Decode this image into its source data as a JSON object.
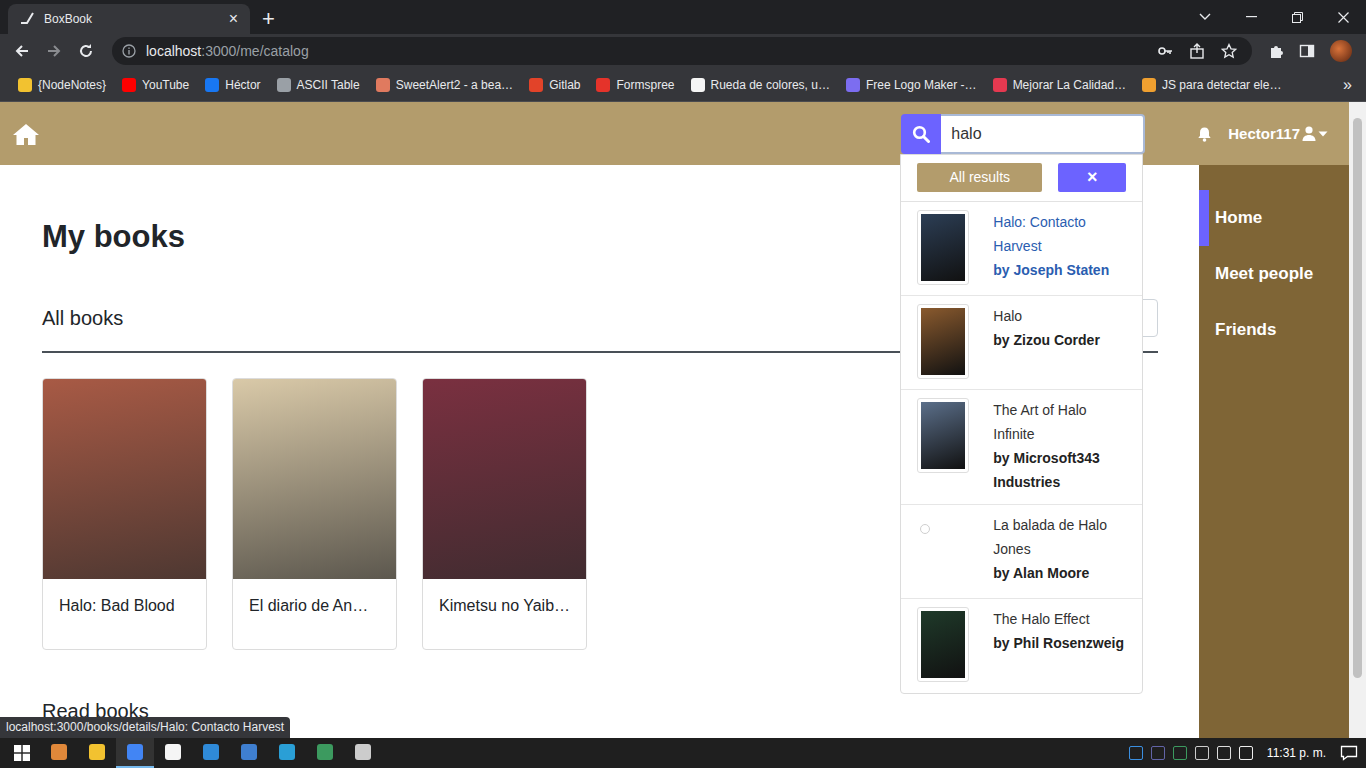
{
  "window": {
    "tab_title": "BoxBook",
    "tab_close": "×",
    "new_tab": "+"
  },
  "toolbar": {
    "url_host": "localhost",
    "url_path": ":3000/me/catalog"
  },
  "bookmarks": [
    {
      "label": "{NodeNotes}",
      "color": "#f2c230"
    },
    {
      "label": "YouTube",
      "color": "#ff0000"
    },
    {
      "label": "Héctor",
      "color": "#1877f2"
    },
    {
      "label": "ASCII Table",
      "color": "#9aa0a6"
    },
    {
      "label": "SweetAlert2 - a bea…",
      "color": "#e07a5f"
    },
    {
      "label": "Gitlab",
      "color": "#e24329"
    },
    {
      "label": "Formspree",
      "color": "#e5332a"
    },
    {
      "label": "Rueda de colores, u…",
      "color": "#f5f5f5"
    },
    {
      "label": "Free Logo Maker -…",
      "color": "#7c6df0"
    },
    {
      "label": "Mejorar La Calidad…",
      "color": "#e53950"
    },
    {
      "label": "JS para detectar ele…",
      "color": "#f0a030"
    }
  ],
  "bookmarks_more": "»",
  "navbar": {
    "search_value": "halo",
    "user": "Hector117"
  },
  "search_dropdown": {
    "all_results": "All results",
    "close": "×",
    "results": [
      {
        "title": "Halo: Contacto Harvest",
        "author": "by Joseph Staten",
        "hovered": true,
        "has_cover": true,
        "color": "#2c3e55"
      },
      {
        "title": "Halo",
        "author": "by Zizou Corder",
        "hovered": false,
        "has_cover": true,
        "color": "#8a5a2e"
      },
      {
        "title": "The Art of Halo Infinite",
        "author": "by Microsoft343 Industries",
        "hovered": false,
        "has_cover": true,
        "color": "#5b6f8a"
      },
      {
        "title": "La balada de Halo Jones",
        "author": "by Alan Moore",
        "hovered": false,
        "has_cover": false,
        "color": "#ffffff"
      },
      {
        "title": "The Halo Effect",
        "author": "by Phil Rosenzweig",
        "hovered": false,
        "has_cover": true,
        "color": "#1f3a2a"
      }
    ]
  },
  "sidebar": {
    "items": [
      {
        "label": "Home",
        "selected": true
      },
      {
        "label": "Meet people",
        "selected": false
      },
      {
        "label": "Friends",
        "selected": false
      }
    ]
  },
  "page": {
    "title": "My books",
    "all_books": "All books",
    "books": [
      {
        "title": "Halo: Bad Blood",
        "color": "#a85a45"
      },
      {
        "title": "El diario de An…",
        "color": "#d9c9a8"
      },
      {
        "title": "Kimetsu no Yaib…",
        "color": "#7a3040"
      }
    ],
    "read_books": "Read books"
  },
  "status_url": "localhost:3000/books/details/Halo: Contacto Harvest",
  "taskbar": {
    "apps": [
      {
        "color": "#e0883a",
        "selected": false
      },
      {
        "color": "#f2c230",
        "selected": false
      },
      {
        "color": "#4285f4",
        "selected": true
      },
      {
        "color": "#f5f5f5",
        "selected": false
      },
      {
        "color": "#2f8ad8",
        "selected": false
      },
      {
        "color": "#3f7fd0",
        "selected": false
      },
      {
        "color": "#2a9fd6",
        "selected": false
      },
      {
        "color": "#3c9a5f",
        "selected": false
      },
      {
        "color": "#cccccc",
        "selected": false
      }
    ],
    "clock": "11:31 p. m."
  }
}
